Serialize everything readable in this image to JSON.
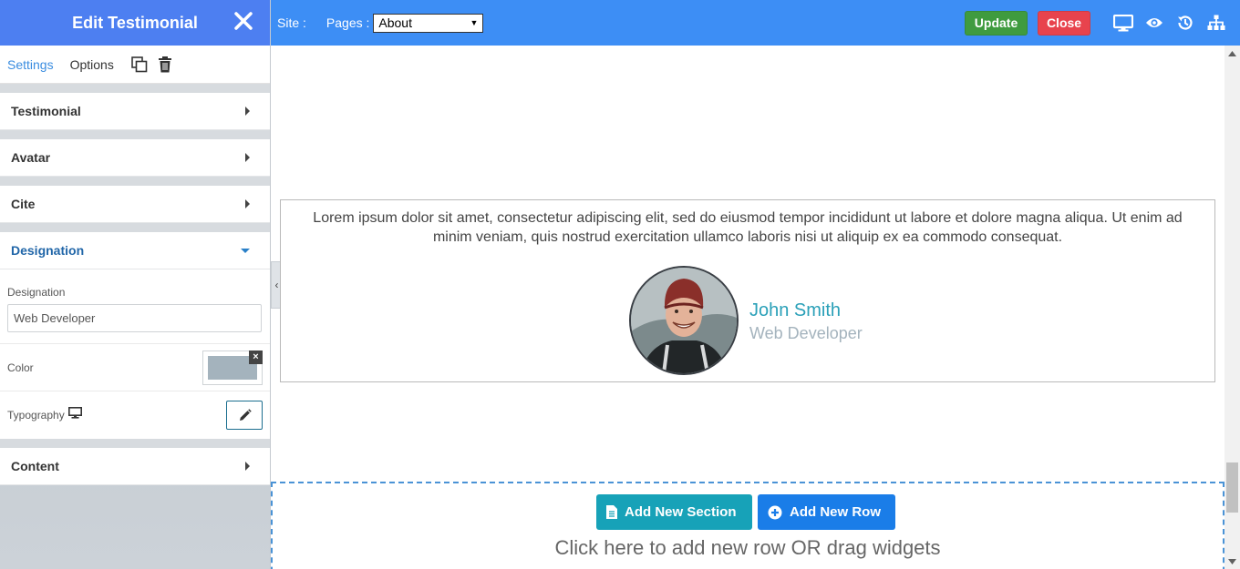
{
  "sidebar": {
    "title": "Edit Testimonial",
    "tabs": [
      {
        "label": "Settings"
      },
      {
        "label": "Options"
      }
    ],
    "sections": {
      "testimonial": "Testimonial",
      "avatar": "Avatar",
      "cite": "Cite",
      "designation": "Designation",
      "content": "Content"
    },
    "designation_panel": {
      "field_label": "Designation",
      "field_value": "Web Developer",
      "color_label": "Color",
      "color_value": "#a4b3bd",
      "clear_glyph": "×",
      "typography_label": "Typography"
    }
  },
  "topbar": {
    "site_label": "Site :",
    "pages_label": "Pages :",
    "pages_selected": "About",
    "update_label": "Update",
    "close_label": "Close",
    "icons": [
      "desktop-icon",
      "eye-icon",
      "history-icon",
      "sitemap-icon"
    ]
  },
  "canvas": {
    "collapse_glyph": "‹",
    "testimonial": {
      "text": "Lorem ipsum dolor sit amet, consectetur adipiscing elit, sed do eiusmod tempor incididunt ut labore et dolore magna aliqua. Ut enim ad minim veniam, quis nostrud exercitation ullamco laboris nisi ut aliquip ex ea commodo consequat.",
      "name": "John Smith",
      "designation": "Web Developer"
    },
    "add_section_label": "Add New Section",
    "add_row_label": "Add New Row",
    "add_hint": "Click here to add new row OR drag widgets"
  },
  "colors": {
    "topbar": "#3d8ef5",
    "sidebar_header": "#4d7ff1",
    "update": "#3f9b3f",
    "close": "#e8434d",
    "add_section": "#17a2b8",
    "add_row": "#1a7de8",
    "cite_name": "#2aa0b8"
  }
}
